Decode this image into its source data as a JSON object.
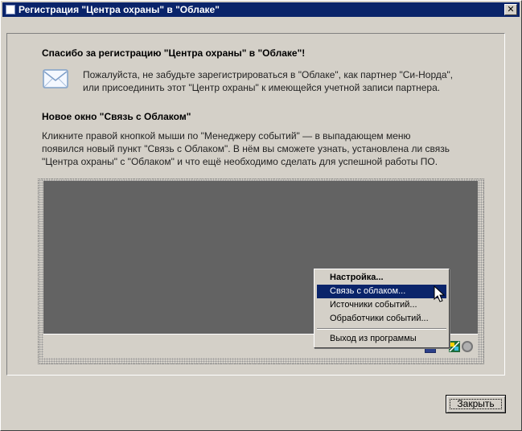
{
  "window": {
    "title": "Регистрация \"Центра охраны\" в \"Облаке\"",
    "close_glyph": "✕"
  },
  "section1": {
    "heading": "Спасибо за регистрацию \"Центра охраны\" в \"Облаке\"!",
    "line1": "Пожалуйста, не забудьте зарегистрироваться в \"Облаке\", как партнер \"Си-Норда\",",
    "line2": "или присоединить этот \"Центр охраны\" к имеющейся учетной записи партнера."
  },
  "section2": {
    "heading": "Новое окно \"Связь с Облаком\"",
    "line1": "Кликните правой кнопкой мыши по \"Менеджеру событий\" — в выпадающем меню",
    "line2": "появился новый пункт \"Связь с Облаком\". В нём вы сможете узнать, установлена ли связь",
    "line3": "\"Центра охраны\" с \"Облаком\" и что ещё необходимо сделать для успешной работы ПО."
  },
  "context_menu": {
    "items": [
      {
        "label": "Настройка..."
      },
      {
        "label": "Связь с облаком..."
      },
      {
        "label": "Источники событий..."
      },
      {
        "label": "Обработчики событий..."
      },
      {
        "label": "Выход из программы"
      }
    ]
  },
  "icons": {
    "envelope": "envelope-icon",
    "cursor": "mouse-pointer-icon"
  },
  "colors": {
    "titlebar": "#0a246a",
    "menu_highlight": "#0a246a",
    "window_bg": "#d4d0c8",
    "desktop": "#636363"
  },
  "footer": {
    "close_label": "Закрыть"
  }
}
